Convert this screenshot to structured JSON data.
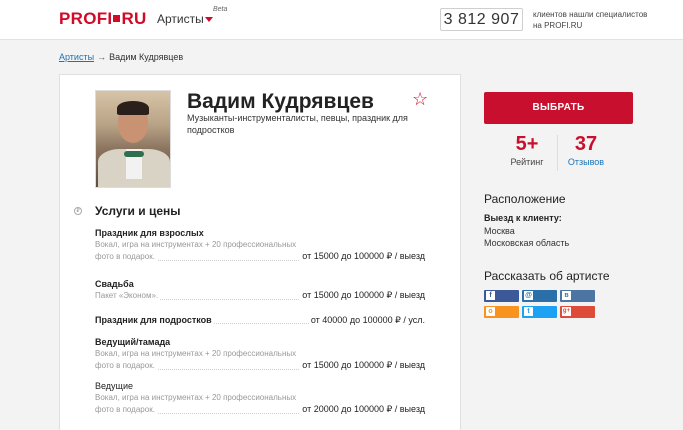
{
  "header": {
    "logo": "PROFI",
    "logo_suffix": "RU",
    "nav_category": "Артисты",
    "beta": "Beta",
    "counter": "3 812 907",
    "counter_label": "клиентов нашли специалистов на PROFI.RU"
  },
  "breadcrumb": {
    "link": "Артисты",
    "arrow": "→",
    "current": "Вадим Кудрявцев"
  },
  "profile": {
    "name": "Вадим Кудрявцев",
    "specialties": "Музыканты-инструменталисты, певцы, праздник для подростков",
    "favorite_icon": "star-outline-icon"
  },
  "services": {
    "title": "Услуги и цены",
    "items": [
      {
        "title": "Праздник для взрослых",
        "desc1": "Вокал, игра на инструментах + 20 профессиональных",
        "desc2": "фото в подарок.",
        "price": "от 15000 до 100000 ₽ / выезд"
      },
      {
        "title": "Свадьба",
        "desc1": "",
        "desc2": "Пакет «Эконом».",
        "price": "от 15000 до 100000 ₽ / выезд"
      },
      {
        "title": "Праздник для подростков",
        "price": "от 40000 до 100000 ₽ / усл."
      },
      {
        "title": "Ведущий/тамада",
        "desc1": "Вокал, игра на инструментах + 20 профессиональных",
        "desc2": "фото в подарок.",
        "price": "от 15000 до 100000 ₽ / выезд"
      },
      {
        "title": "Ведущие",
        "desc1": "Вокал, игра на инструментах + 20 профессиональных",
        "desc2": "фото в подарок.",
        "price": "от 20000 до 100000 ₽ / выезд"
      }
    ]
  },
  "sidebar": {
    "choose_button": "ВЫБРАТЬ",
    "rating_value": "5+",
    "rating_label": "Рейтинг",
    "reviews_value": "37",
    "reviews_label": "Отзывов",
    "location_title": "Расположение",
    "location_sub": "Выезд к клиенту:",
    "locations": [
      "Москва",
      "Московская область"
    ],
    "share_title": "Рассказать об артисте",
    "social": [
      {
        "name": "facebook-icon",
        "glyph": "f",
        "color": "#3b5998"
      },
      {
        "name": "livejournal-icon",
        "glyph": "@",
        "color": "#2a6fa7"
      },
      {
        "name": "vk-icon",
        "glyph": "в",
        "color": "#4c75a3"
      },
      {
        "name": "odnoklassniki-icon",
        "glyph": "о",
        "color": "#f7931e"
      },
      {
        "name": "twitter-icon",
        "glyph": "t",
        "color": "#1da1f2"
      },
      {
        "name": "google-plus-icon",
        "glyph": "g+",
        "color": "#dd4b39"
      }
    ]
  },
  "colors": {
    "brand": "#d10a2a",
    "button": "#c8102e",
    "link": "#1a73b8"
  }
}
